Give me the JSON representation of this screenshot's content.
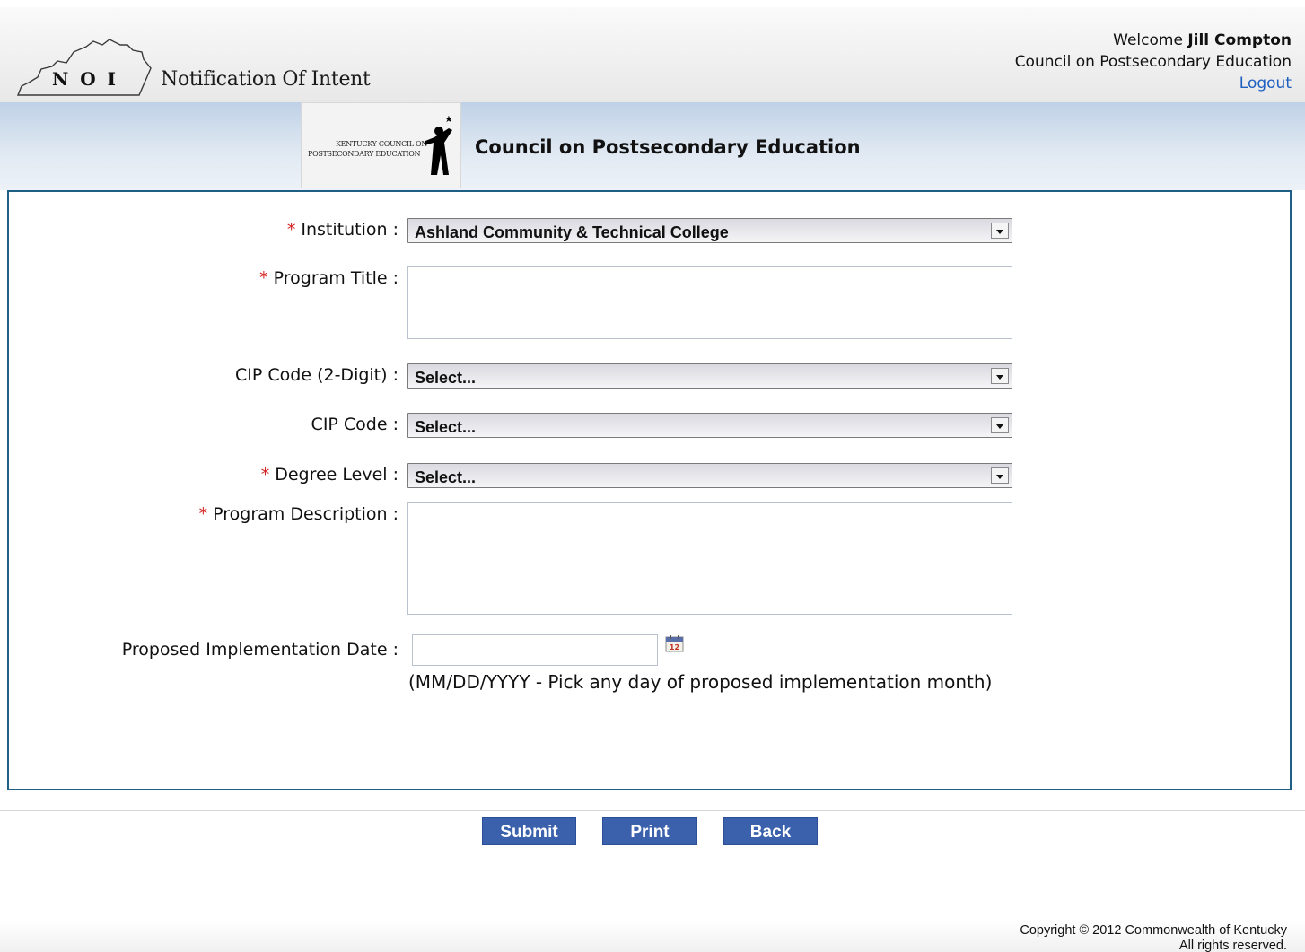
{
  "header": {
    "logo_text": "N O I",
    "app_title": "Notification Of Intent",
    "welcome_prefix": "Welcome",
    "user_name": "Jill Compton",
    "organization": "Council on Postsecondary Education",
    "logout_label": "Logout"
  },
  "banner": {
    "logo_line1": "KENTUCKY COUNCIL ON",
    "logo_line2": "POSTSECONDARY EDUCATION",
    "title": "Council on Postsecondary Education"
  },
  "form": {
    "institution": {
      "label": "Institution :",
      "required": true,
      "value": "Ashland Community & Technical College"
    },
    "program_title": {
      "label": "Program Title :",
      "required": true,
      "value": ""
    },
    "cip_2digit": {
      "label": "CIP Code (2-Digit) :",
      "required": false,
      "value": "Select..."
    },
    "cip_code": {
      "label": "CIP Code :",
      "required": false,
      "value": "Select..."
    },
    "degree_level": {
      "label": "Degree Level :",
      "required": true,
      "value": "Select..."
    },
    "program_description": {
      "label": "Program Description :",
      "required": true,
      "value": ""
    },
    "implementation_date": {
      "label": "Proposed Implementation Date :",
      "value": "",
      "hint": "(MM/DD/YYYY - Pick any day of proposed implementation month)",
      "calendar_icon": "calendar-icon"
    }
  },
  "buttons": {
    "submit": "Submit",
    "print": "Print",
    "back": "Back"
  },
  "footer": {
    "copyright": "Copyright © 2012 Commonwealth of Kentucky",
    "rights": "All rights reserved."
  },
  "colors": {
    "accent_button": "#3b61ad",
    "panel_border": "#1f5f86",
    "required": "#d42020",
    "link": "#1d5fbf"
  }
}
